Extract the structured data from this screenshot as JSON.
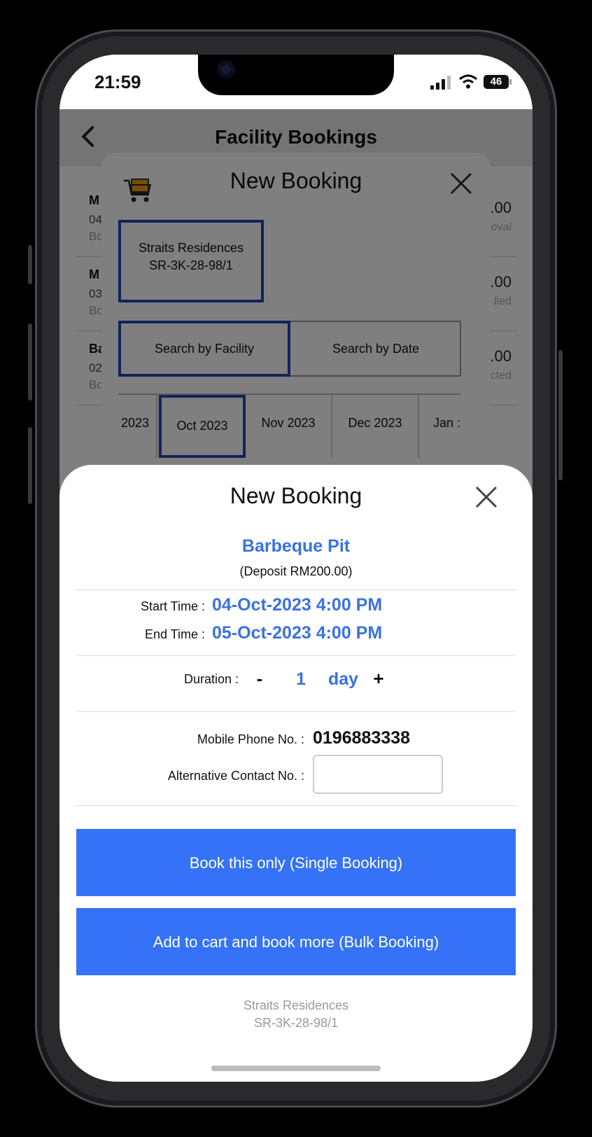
{
  "status_bar": {
    "time": "21:59",
    "battery": "46"
  },
  "app": {
    "title": "Facility Bookings",
    "list": [
      {
        "title": "M",
        "date": "04",
        "sub": "Bo",
        "amount": ".00",
        "status": "oval"
      },
      {
        "title": "M",
        "date": "03",
        "sub": "Bo",
        "amount": ".00",
        "status": "lled"
      },
      {
        "title": "Ba",
        "date": "02",
        "sub": "Bo",
        "amount": ".00",
        "status": "cted"
      }
    ]
  },
  "booking_modal": {
    "title": "New Booking",
    "unit_line1": "Straits Residences",
    "unit_line2": "SR-3K-28-98/1",
    "tabs": {
      "facility": "Search by Facility",
      "date": "Search by Date"
    },
    "months": [
      "2023",
      "Oct 2023",
      "Nov 2023",
      "Dec 2023",
      "Jan :"
    ],
    "selected_month": "Oct 2023"
  },
  "sheet": {
    "title": "New Booking",
    "facility": "Barbeque Pit",
    "deposit": "(Deposit RM200.00)",
    "start_label": "Start Time :",
    "start_value": "04-Oct-2023 4:00 PM",
    "end_label": "End Time :",
    "end_value": "05-Oct-2023 4:00 PM",
    "duration_label": "Duration :",
    "duration_minus": "-",
    "duration_value": "1",
    "duration_unit": "day",
    "duration_plus": "+",
    "mobile_label": "Mobile Phone No. :",
    "mobile_value": "0196883338",
    "alt_label": "Alternative Contact No. :",
    "alt_value": "",
    "single_button": "Book this only (Single Booking)",
    "bulk_button": "Add to cart and book more (Bulk Booking)",
    "footer_line1": "Straits Residences",
    "footer_line2": "SR-3K-28-98/1"
  },
  "colors": {
    "accent": "#3572f8",
    "link_blue": "#3a72e0",
    "selection_border": "#2546b8"
  },
  "icons": [
    "cart-icon",
    "close-icon",
    "back-chevron-icon",
    "signal-icon",
    "wifi-icon",
    "battery-icon"
  ]
}
